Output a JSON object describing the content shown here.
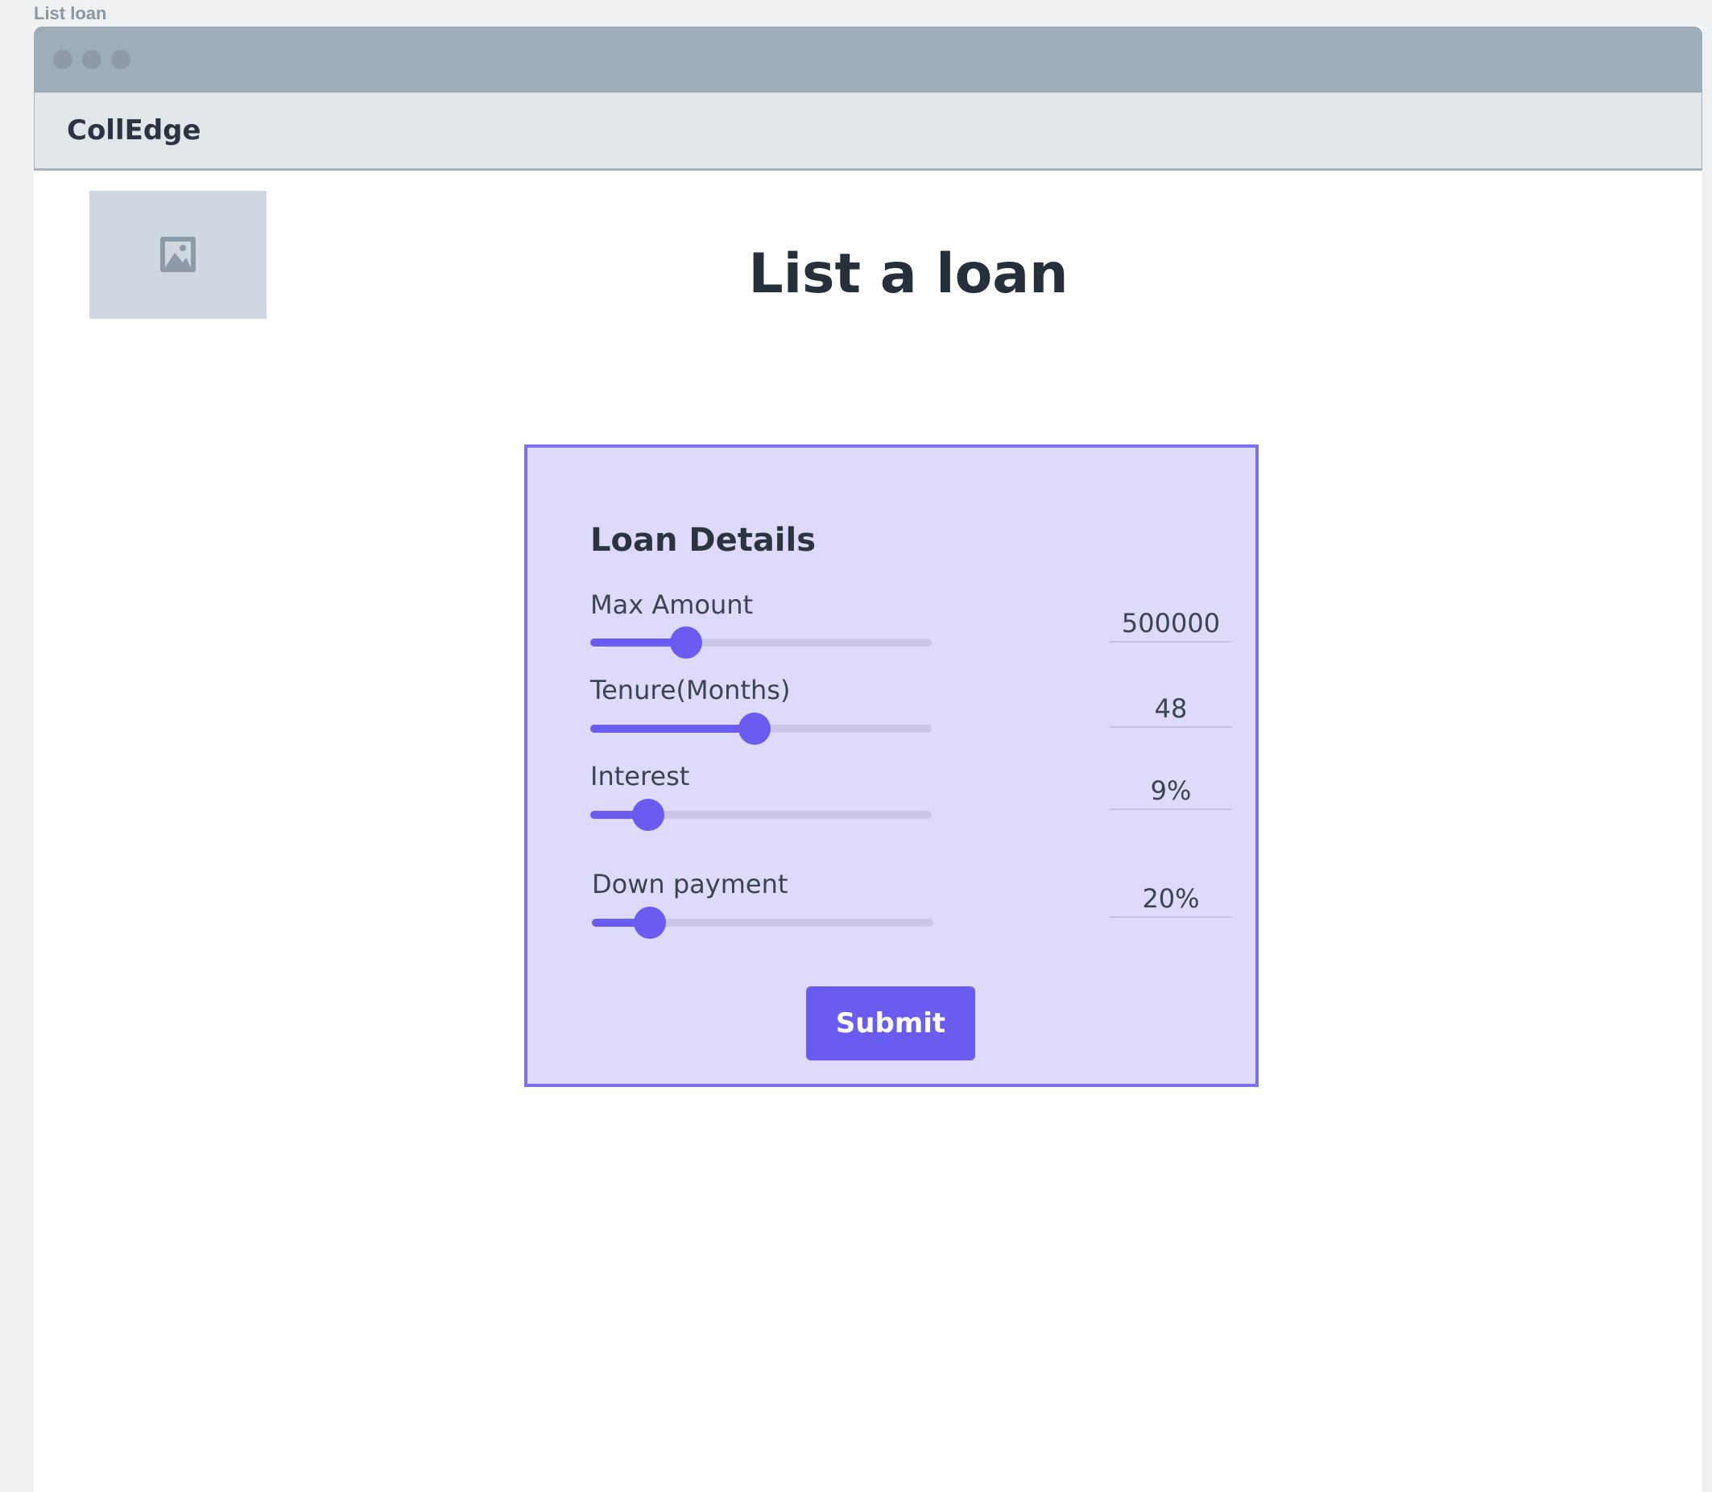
{
  "frame": {
    "label": "List loan"
  },
  "navbar": {
    "brand": "CollEdge"
  },
  "page": {
    "title": "List a loan"
  },
  "loan_details": {
    "title": "Loan Details",
    "fields": [
      {
        "label": "Max Amount",
        "value": "500000",
        "slider_level_percent": 28
      },
      {
        "label": "Tenure(Months)",
        "value": "48",
        "slider_level_percent": 48
      },
      {
        "label": "Interest",
        "value": "9%",
        "slider_level_percent": 17
      },
      {
        "label": "Down payment",
        "value": "20%",
        "slider_level_percent": 17
      }
    ],
    "submit_label": "Submit"
  },
  "colors": {
    "accent": "#6a5cf0",
    "card_background": "#dddafa",
    "card_border": "#7c6ff0",
    "titlebar": "#9eadba",
    "navbar": "#e1e6eb"
  },
  "icons": {
    "image_placeholder": "image-icon"
  }
}
